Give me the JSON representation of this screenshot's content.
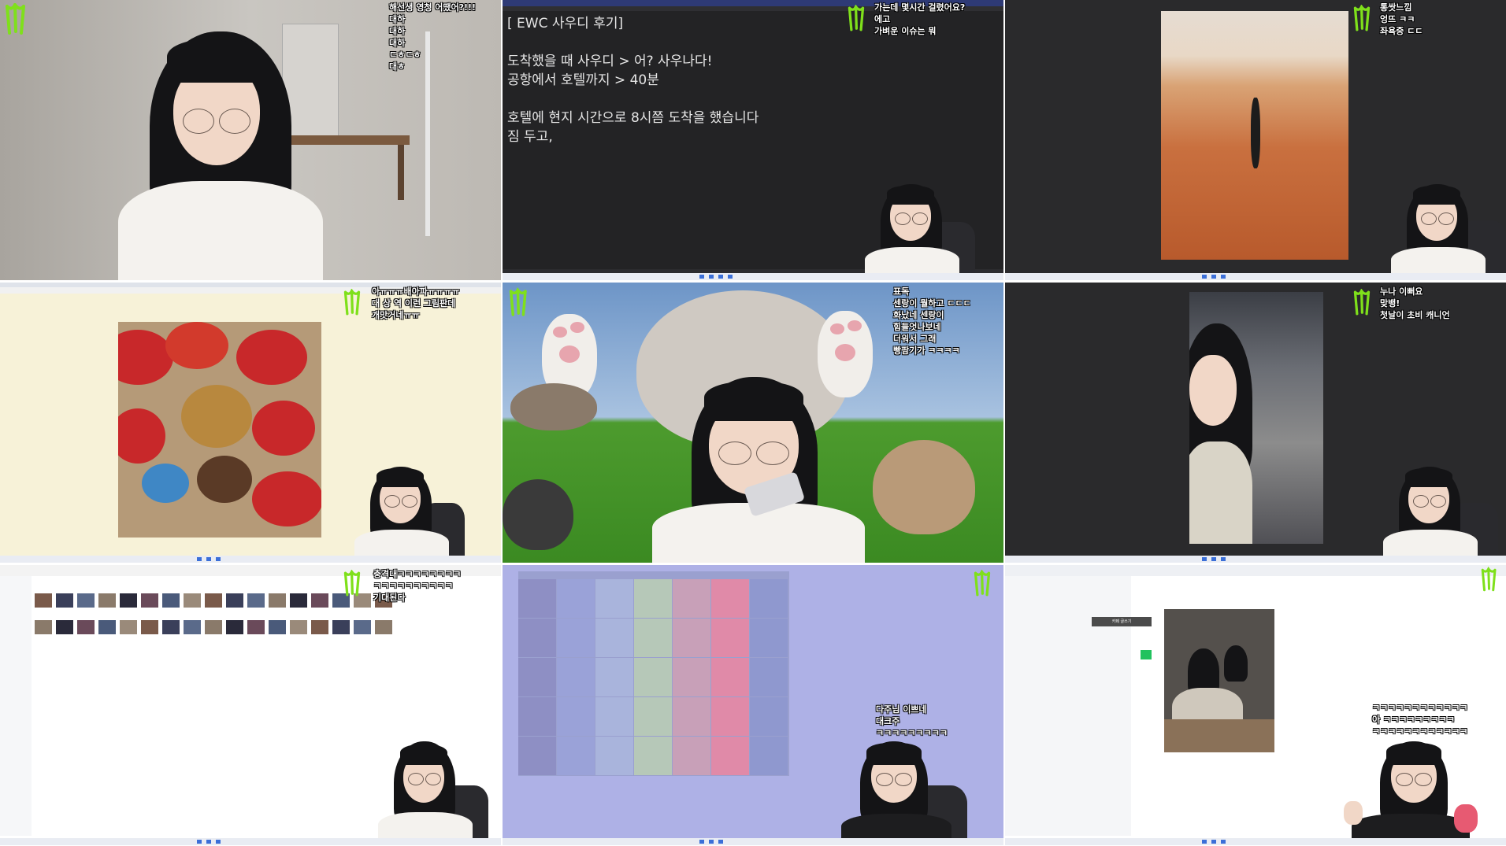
{
  "tiles": {
    "t1": {
      "chat": [
        "해선생 영청 어땠어?!!!",
        "대하",
        "대하",
        "대하",
        "ㄷㅎㄷㅎ",
        "대ㅎ"
      ]
    },
    "t2": {
      "doc_lines": [
        "[ EWC 사우디 후기]",
        "",
        "도착했을 때 사우디 > 어? 사우나다!",
        "공항에서 호텔까지 > 40분",
        "",
        "호텔에 현지 시간으로 8시쯤 도착을 했습니다",
        "짐 두고,"
      ],
      "chat": [
        "가는데 몇시간 걸렸어요?",
        "에고",
        "가벼운 이슈는 뭐"
      ]
    },
    "t3": {
      "chat": [
        "통쌋느낌",
        "엉뜨 ㅋㅋ",
        "좌욕중 ㄷㄷ"
      ]
    },
    "t4": {
      "chat": [
        "아ㅠㅠㅠ배아파ㅠㅠㅠㅠ",
        "대 상 역 이런 그림판데",
        "개맛거네ㅠㅠ"
      ]
    },
    "t5": {
      "chat": [
        "표독",
        "센랑이 뭘하고 ㄷㄷㄷ",
        "화났네 센랑이",
        "힘들엇나보네",
        "더워서 그래",
        "빵팜기가 ㅋㅋㅋㅋ"
      ]
    },
    "t6": {
      "chat": [
        "누나 이뻐요",
        "맞뱅!",
        "첫날이 초비 캐니언"
      ]
    },
    "t7": {
      "chat": [
        "충격대ㅋㅋㅋㅋㅋㅋㅋㅋ",
        "ㅋㅋㅋㅋㅋㅋㅋㅋㅋㅋ",
        "기대된다"
      ]
    },
    "t8": {
      "chat": [
        "다주님 이쁘네",
        "대크주",
        "ㅋㅋㅋㅋㅋㅋㅋㅋㅋ"
      ]
    },
    "t9": {
      "button": "카페 글쓰기",
      "chat": [
        "ㅋㅋㅋㅋㅋㅋㅋㅋㅋㅋㅋㅋ",
        "아 ㅋㅋㅋㅋㅋㅋㅋㅋㅋ",
        "ㅋㅋㅋㅋㅋㅋㅋㅋㅋㅋㅋㅋ"
      ]
    }
  },
  "colors": {
    "monster_green": "#7fe01b",
    "notepad_bg": "#232325",
    "calendar_bg": "#aeb1e6"
  }
}
